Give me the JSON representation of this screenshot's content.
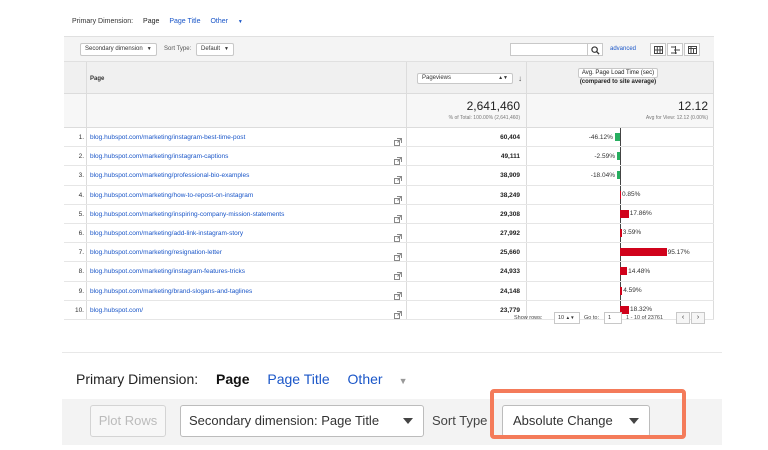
{
  "top": {
    "primary_dimension": {
      "label": "Primary Dimension:",
      "active": "Page",
      "options": [
        "Page Title",
        "Other"
      ]
    },
    "toolbar": {
      "secondary_dimension": "Secondary dimension",
      "sort_type_label": "Sort Type:",
      "sort_type_value": "Default",
      "advanced_link": "advanced"
    },
    "table": {
      "col_page": "Page",
      "col_pageviews": "Pageviews",
      "col_alt_line1": "Avg. Page Load Time (sec)",
      "col_alt_line2": "(compared to site average)",
      "total_pageviews": "2,641,460",
      "total_pageviews_sub": "% of Total: 100.00% (2,641,460)",
      "total_alt": "12.12",
      "total_alt_sub": "Avg for View: 12.12 (0.00%)",
      "rows": [
        {
          "num": "1.",
          "page": "blog.hubspot.com/marketing/instagram-best-time-post",
          "pageviews": "60,404",
          "pct_label": "-46.12%",
          "pct": -46.12
        },
        {
          "num": "2.",
          "page": "blog.hubspot.com/marketing/instagram-captions",
          "pageviews": "49,111",
          "pct_label": "-2.59%",
          "pct": -2.59
        },
        {
          "num": "3.",
          "page": "blog.hubspot.com/marketing/professional-bio-examples",
          "pageviews": "38,909",
          "pct_label": "-18.04%",
          "pct": -18.04
        },
        {
          "num": "4.",
          "page": "blog.hubspot.com/marketing/how-to-repost-on-instagram",
          "pageviews": "38,249",
          "pct_label": "0.85%",
          "pct": 0.85
        },
        {
          "num": "5.",
          "page": "blog.hubspot.com/marketing/inspiring-company-mission-statements",
          "pageviews": "29,308",
          "pct_label": "17.86%",
          "pct": 17.86
        },
        {
          "num": "6.",
          "page": "blog.hubspot.com/marketing/add-link-instagram-story",
          "pageviews": "27,992",
          "pct_label": "3.59%",
          "pct": 3.59
        },
        {
          "num": "7.",
          "page": "blog.hubspot.com/marketing/resignation-letter",
          "pageviews": "25,660",
          "pct_label": "95.17%",
          "pct": 95.17
        },
        {
          "num": "8.",
          "page": "blog.hubspot.com/marketing/instagram-features-tricks",
          "pageviews": "24,933",
          "pct_label": "14.48%",
          "pct": 14.48
        },
        {
          "num": "9.",
          "page": "blog.hubspot.com/marketing/brand-slogans-and-taglines",
          "pageviews": "24,148",
          "pct_label": "4.59%",
          "pct": 4.59
        },
        {
          "num": "10.",
          "page": "blog.hubspot.com/",
          "pageviews": "23,779",
          "pct_label": "18.32%",
          "pct": 18.32
        }
      ]
    },
    "pager": {
      "show_rows_label": "Show rows:",
      "show_rows_value": "10",
      "goto_label": "Go to:",
      "goto_value": "1",
      "range": "1 - 10 of 23761",
      "prev": "‹",
      "next": "›"
    }
  },
  "bottom": {
    "primary_dimension": {
      "label": "Primary Dimension:",
      "active": "Page",
      "options": [
        "Page Title",
        "Other"
      ]
    },
    "plot_rows": "Plot Rows",
    "secondary_dimension": "Secondary dimension: Page Title",
    "sort_type_label": "Sort Type",
    "sort_type_value": "Absolute Change"
  },
  "colors": {
    "link": "#1a56c8",
    "positive_bar": "#d0021b",
    "negative_bar": "#27ae60",
    "highlight": "#f47b5a"
  }
}
